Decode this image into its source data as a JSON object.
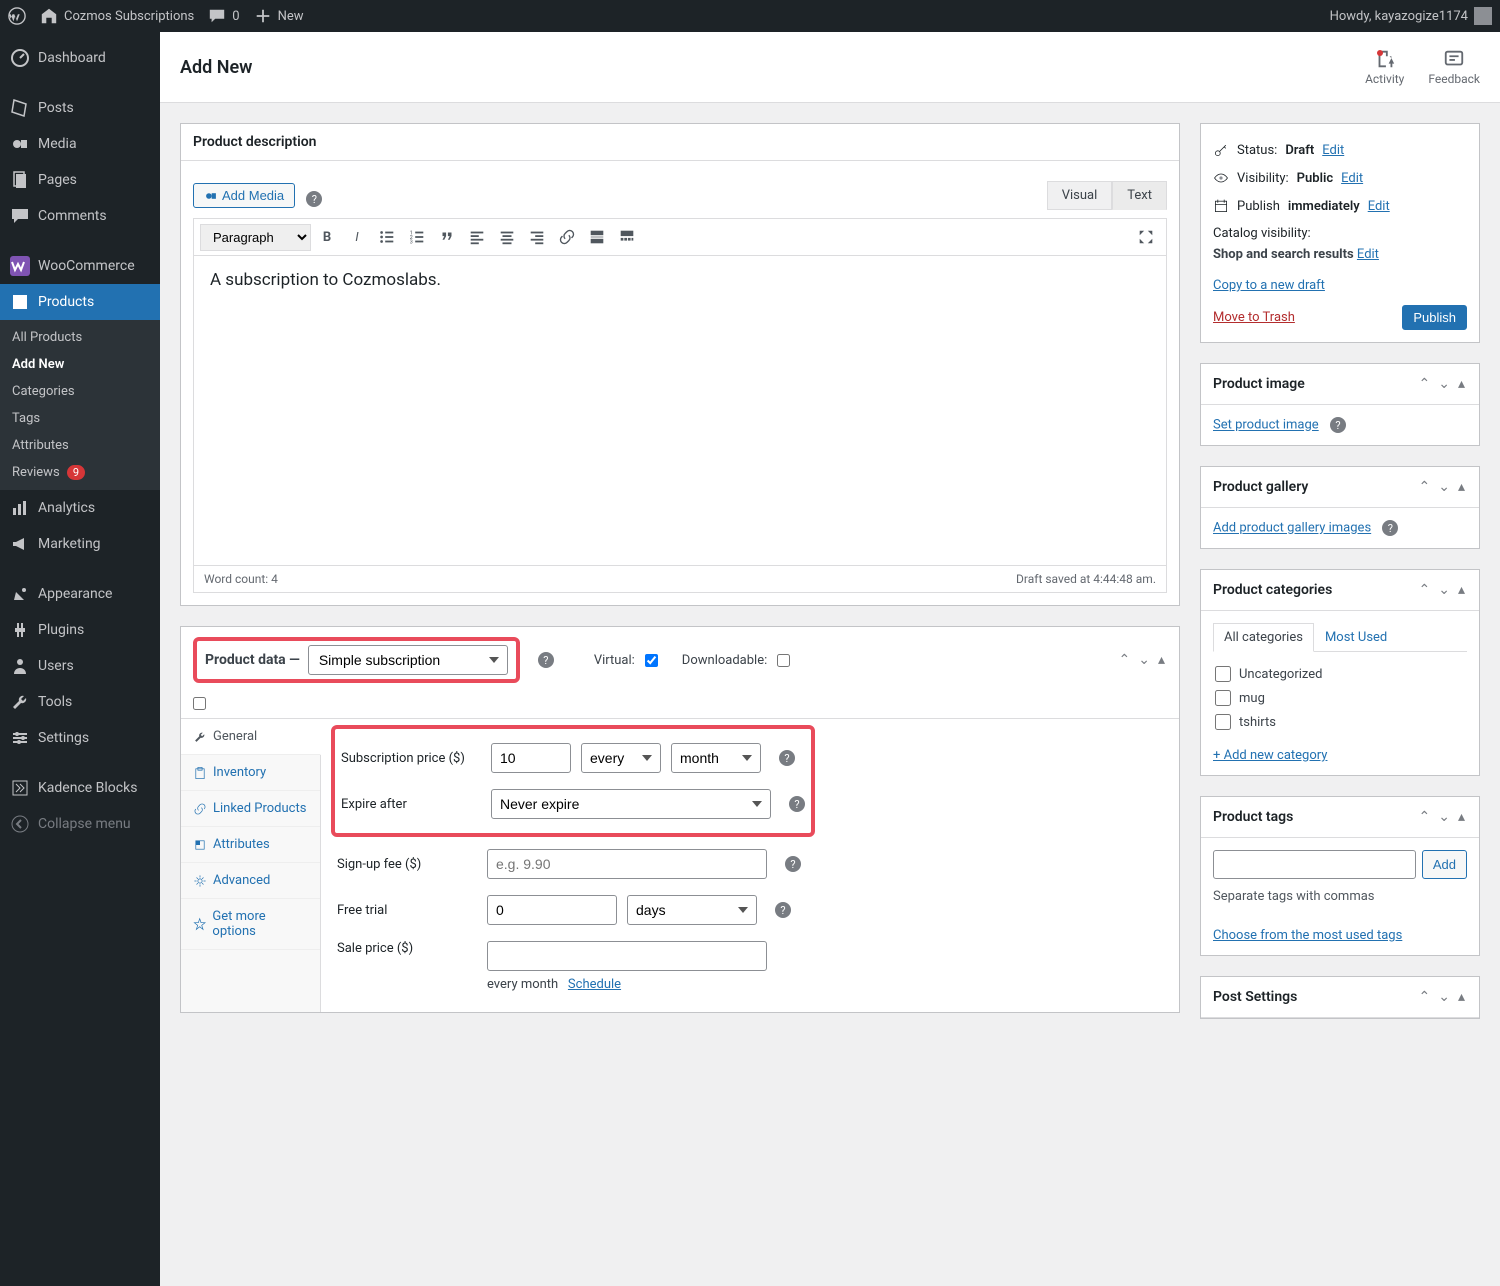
{
  "adminbar": {
    "site_name": "Cozmos Subscriptions",
    "comments": "0",
    "new": "New",
    "howdy": "Howdy, kayazogize1174"
  },
  "sidebar": {
    "dashboard": "Dashboard",
    "posts": "Posts",
    "media": "Media",
    "pages": "Pages",
    "comments": "Comments",
    "woocommerce": "WooCommerce",
    "products": "Products",
    "products_sub": {
      "all": "All Products",
      "add_new": "Add New",
      "categories": "Categories",
      "tags": "Tags",
      "attributes": "Attributes",
      "reviews": "Reviews",
      "reviews_count": "9"
    },
    "analytics": "Analytics",
    "marketing": "Marketing",
    "appearance": "Appearance",
    "plugins": "Plugins",
    "users": "Users",
    "tools": "Tools",
    "settings": "Settings",
    "kadence": "Kadence Blocks",
    "collapse": "Collapse menu"
  },
  "page": {
    "title": "Add New",
    "activity": "Activity",
    "feedback": "Feedback"
  },
  "description_panel": {
    "title": "Product description",
    "add_media": "Add Media",
    "visual_tab": "Visual",
    "text_tab": "Text",
    "paragraph": "Paragraph",
    "content": "A subscription to Cozmoslabs.",
    "word_count": "Word count: 4",
    "draft_saved": "Draft saved at 4:44:48 am."
  },
  "product_data": {
    "label": "Product data —",
    "type": "Simple subscription",
    "virtual_label": "Virtual:",
    "downloadable_label": "Downloadable:",
    "tabs": {
      "general": "General",
      "inventory": "Inventory",
      "linked": "Linked Products",
      "attributes": "Attributes",
      "advanced": "Advanced",
      "get_more": "Get more options"
    },
    "fields": {
      "sub_price_label": "Subscription price ($)",
      "sub_price_value": "10",
      "sub_every": "every",
      "sub_period": "month",
      "expire_label": "Expire after",
      "expire_value": "Never expire",
      "signup_label": "Sign-up fee ($)",
      "signup_placeholder": "e.g. 9.90",
      "trial_label": "Free trial",
      "trial_value": "0",
      "trial_unit": "days",
      "sale_label": "Sale price ($)",
      "sale_period": "every month",
      "schedule": "Schedule"
    }
  },
  "publish": {
    "status_label": "Status:",
    "status_value": "Draft",
    "visibility_label": "Visibility:",
    "visibility_value": "Public",
    "publish_label": "Publish",
    "publish_value": "immediately",
    "catalog_label": "Catalog visibility:",
    "catalog_value": "Shop and search results",
    "edit": "Edit",
    "copy_draft": "Copy to a new draft",
    "move_trash": "Move to Trash",
    "publish_btn": "Publish"
  },
  "product_image": {
    "title": "Product image",
    "set": "Set product image"
  },
  "product_gallery": {
    "title": "Product gallery",
    "add": "Add product gallery images"
  },
  "product_categories": {
    "title": "Product categories",
    "all_tab": "All categories",
    "most_used_tab": "Most Used",
    "cats": {
      "uncategorized": "Uncategorized",
      "mug": "mug",
      "tshirts": "tshirts"
    },
    "add_new": "+ Add new category"
  },
  "product_tags": {
    "title": "Product tags",
    "add": "Add",
    "separate": "Separate tags with commas",
    "choose": "Choose from the most used tags"
  },
  "post_settings": {
    "title": "Post Settings"
  }
}
